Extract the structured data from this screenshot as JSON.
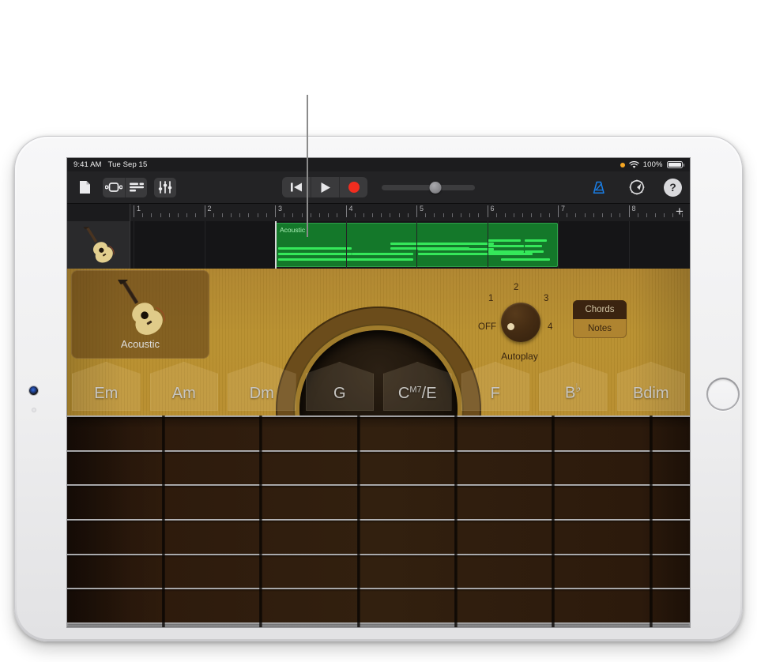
{
  "status_bar": {
    "time": "9:41 AM",
    "date": "Tue Sep 15",
    "battery_percent": "100%",
    "wifi_icon": "wifi-icon",
    "recording_dot": "orange-recording-indicator"
  },
  "toolbar": {
    "left_buttons": [
      {
        "name": "my-songs-button",
        "icon": "document-icon",
        "label": "My Songs"
      },
      {
        "name": "instrument-view-button",
        "icon": "instrument-view-icon",
        "label": "Instrument View"
      },
      {
        "name": "tracks-view-button",
        "icon": "tracks-view-icon",
        "label": "Tracks View"
      },
      {
        "name": "mixer-button",
        "icon": "mixer-sliders-icon",
        "label": "Mixer"
      }
    ],
    "transport": [
      {
        "name": "rewind-button",
        "icon": "rewind-to-start-icon",
        "label": "Go to Beginning"
      },
      {
        "name": "play-button",
        "icon": "play-triangle-icon",
        "label": "Play"
      },
      {
        "name": "record-button",
        "icon": "record-dot-icon",
        "label": "Record"
      }
    ],
    "master_volume": {
      "label": "Master Volume",
      "value_percent": 58
    },
    "right_buttons": [
      {
        "name": "metronome-button",
        "icon": "metronome-off-icon",
        "label": "Metronome",
        "state": "off",
        "color": "#1a7fe8"
      },
      {
        "name": "settings-button",
        "icon": "gear-icon",
        "label": "Song Settings"
      },
      {
        "name": "help-button",
        "icon": "question-mark-icon",
        "label": "Help"
      }
    ]
  },
  "ruler": {
    "bars": [
      "1",
      "2",
      "3",
      "4",
      "5",
      "6",
      "7",
      "8"
    ],
    "playhead_bar": "3",
    "add_button_label": "+"
  },
  "track": {
    "header_icon": "acoustic-guitar-icon",
    "region_name": "Acoustic",
    "region_color": "#14782a"
  },
  "instrument": {
    "selector_label": "Acoustic",
    "selector_icon": "acoustic-guitar-icon",
    "autoplay": {
      "caption": "Autoplay",
      "positions": [
        "OFF",
        "1",
        "2",
        "3",
        "4"
      ],
      "selected": "OFF"
    },
    "mode_switch": {
      "options": [
        "Chords",
        "Notes"
      ],
      "selected": "Chords"
    },
    "chords": [
      {
        "root": "Em",
        "sup": "",
        "suffix": ""
      },
      {
        "root": "Am",
        "sup": "",
        "suffix": ""
      },
      {
        "root": "Dm",
        "sup": "",
        "suffix": ""
      },
      {
        "root": "G",
        "sup": "",
        "suffix": ""
      },
      {
        "root": "C",
        "sup": "M7",
        "suffix": "/E"
      },
      {
        "root": "F",
        "sup": "",
        "suffix": ""
      },
      {
        "root": "B",
        "sup": "",
        "suffix": "♭"
      },
      {
        "root": "Bdim",
        "sup": "",
        "suffix": ""
      }
    ],
    "fretboard": {
      "strings": 6,
      "frets": 5
    }
  },
  "device": {
    "type": "iPad",
    "home_button": "home-button",
    "camera": "front-camera-icon"
  },
  "callout": {
    "target": "region-on-timeline"
  }
}
